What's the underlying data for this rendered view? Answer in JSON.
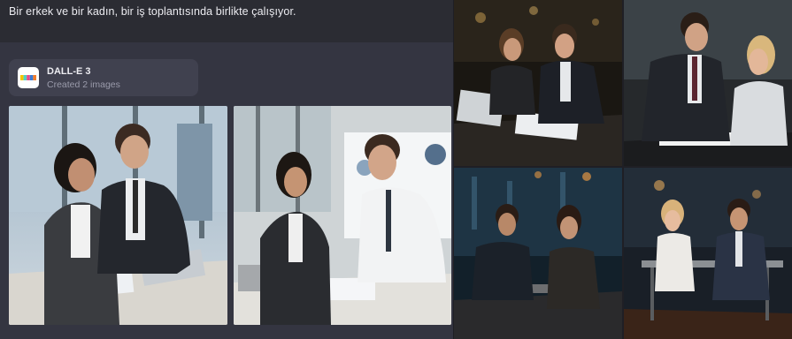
{
  "prompt": {
    "text": "Bir erkek ve bir kadın, bir iş toplantısında birlikte çalışıyor."
  },
  "dalle": {
    "name": "DALL-E 3",
    "subtitle": "Created 2 images",
    "logo_colors": [
      "#f5c400",
      "#4fd1c5",
      "#e64a8a",
      "#3a7bd5",
      "#f27d2b"
    ]
  },
  "colors": {
    "chat_bg": "#343541",
    "prompt_bg": "#2b2c33",
    "card_bg": "#40414f",
    "text_primary": "#ececf1",
    "text_secondary": "#9a9bab"
  },
  "images": {
    "generated": [
      "generated-image-1",
      "generated-image-2"
    ],
    "reference": [
      "photo-1",
      "photo-2",
      "photo-3",
      "photo-4"
    ]
  }
}
